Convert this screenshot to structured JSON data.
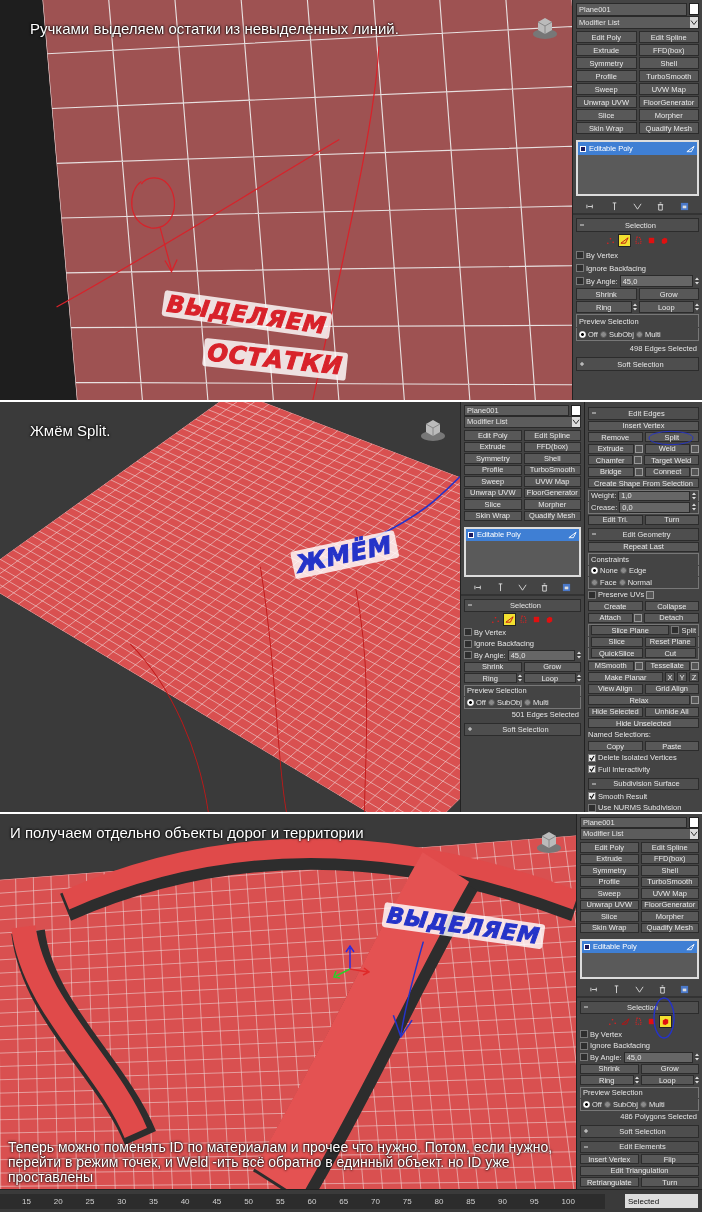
{
  "steps": [
    {
      "caption": "Ручками выделяем остатки из невыделенных линий.",
      "notes": [
        {
          "text": "ВЫДЕЛЯЕМ",
          "color": "#d8222a"
        },
        {
          "text": "ОСТАТКИ",
          "color": "#d8222a"
        }
      ],
      "panels": [
        {
          "object_name": "Plane001",
          "modifier_list": "Modifier List",
          "modifiers": [
            "Edit Poly",
            "Edit Spline",
            "Extrude",
            "FFD(box)",
            "Symmetry",
            "Shell",
            "Profile",
            "TurboSmooth",
            "Sweep",
            "UVW Map",
            "Unwrap UVW",
            "FloorGenerator",
            "Slice",
            "Morpher",
            "Skin Wrap",
            "Quadify Mesh"
          ],
          "stack": [
            {
              "label": "Editable Poly",
              "selected": true
            }
          ],
          "rollouts": [
            {
              "title": "Selection",
              "expanded": true,
              "rows": [
                {
                  "kind": "row",
                  "controls": [
                    {
                      "kind": "subobj",
                      "selected": false
                    },
                    {
                      "kind": "subobj",
                      "selected": true
                    },
                    {
                      "kind": "subobj",
                      "selected": false
                    },
                    {
                      "kind": "subobj",
                      "selected": false
                    },
                    {
                      "kind": "subobj",
                      "selected": false
                    }
                  ]
                },
                {
                  "kind": "row",
                  "controls": [
                    {
                      "kind": "checkbox",
                      "label": "By Vertex",
                      "checked": false
                    }
                  ]
                },
                {
                  "kind": "row",
                  "controls": [
                    {
                      "kind": "checkbox",
                      "label": "Ignore Backfacing",
                      "checked": false
                    }
                  ]
                },
                {
                  "kind": "row",
                  "controls": [
                    {
                      "kind": "checkbox",
                      "label": "By Angle:",
                      "checked": false
                    },
                    {
                      "kind": "spinner",
                      "value": "45,0"
                    }
                  ]
                },
                {
                  "kind": "row",
                  "controls": [
                    {
                      "kind": "button",
                      "label": "Shrink"
                    },
                    {
                      "kind": "button",
                      "label": "Grow"
                    }
                  ]
                },
                {
                  "kind": "row",
                  "controls": [
                    {
                      "kind": "spin_button",
                      "label": "Ring"
                    },
                    {
                      "kind": "spin_button",
                      "label": "Loop"
                    }
                  ]
                },
                {
                  "kind": "group",
                  "title": "Preview Selection",
                  "rows": [
                    {
                      "kind": "row",
                      "controls": [
                        {
                          "kind": "radio",
                          "label": "Off",
                          "selected": true
                        },
                        {
                          "kind": "radio",
                          "label": "SubObj",
                          "selected": false
                        },
                        {
                          "kind": "radio",
                          "label": "Multi",
                          "selected": false
                        }
                      ]
                    }
                  ]
                },
                {
                  "kind": "row",
                  "controls": [
                    {
                      "kind": "status",
                      "text": "498 Edges Selected"
                    }
                  ]
                }
              ]
            },
            {
              "title": "Soft Selection",
              "expanded": false
            }
          ]
        }
      ]
    },
    {
      "caption": "Жмём Split.",
      "notes": [
        {
          "text": "ЖМЁМ",
          "color": "#2533c8"
        }
      ],
      "panels": [
        {
          "object_name": "Plane001",
          "modifier_list": "Modifier List",
          "modifiers": [
            "Edit Poly",
            "Edit Spline",
            "Extrude",
            "FFD(box)",
            "Symmetry",
            "Shell",
            "Profile",
            "TurboSmooth",
            "Sweep",
            "UVW Map",
            "Unwrap UVW",
            "FloorGenerator",
            "Slice",
            "Morpher",
            "Skin Wrap",
            "Quadify Mesh"
          ],
          "stack": [
            {
              "label": "Editable Poly",
              "selected": true
            }
          ],
          "rollouts": [
            {
              "title": "Selection",
              "expanded": true,
              "rows": [
                {
                  "kind": "row",
                  "controls": [
                    {
                      "kind": "subobj",
                      "selected": false
                    },
                    {
                      "kind": "subobj",
                      "selected": true
                    },
                    {
                      "kind": "subobj",
                      "selected": false
                    },
                    {
                      "kind": "subobj",
                      "selected": false
                    },
                    {
                      "kind": "subobj",
                      "selected": false
                    }
                  ]
                },
                {
                  "kind": "row",
                  "controls": [
                    {
                      "kind": "checkbox",
                      "label": "By Vertex",
                      "checked": false
                    }
                  ]
                },
                {
                  "kind": "row",
                  "controls": [
                    {
                      "kind": "checkbox",
                      "label": "Ignore Backfacing",
                      "checked": false
                    }
                  ]
                },
                {
                  "kind": "row",
                  "controls": [
                    {
                      "kind": "checkbox",
                      "label": "By Angle:",
                      "checked": false
                    },
                    {
                      "kind": "spinner",
                      "value": "45,0"
                    }
                  ]
                },
                {
                  "kind": "row",
                  "controls": [
                    {
                      "kind": "button",
                      "label": "Shrink"
                    },
                    {
                      "kind": "button",
                      "label": "Grow"
                    }
                  ]
                },
                {
                  "kind": "row",
                  "controls": [
                    {
                      "kind": "spin_button",
                      "label": "Ring"
                    },
                    {
                      "kind": "spin_button",
                      "label": "Loop"
                    }
                  ]
                },
                {
                  "kind": "group",
                  "title": "Preview Selection",
                  "rows": [
                    {
                      "kind": "row",
                      "controls": [
                        {
                          "kind": "radio",
                          "label": "Off",
                          "selected": true
                        },
                        {
                          "kind": "radio",
                          "label": "SubObj",
                          "selected": false
                        },
                        {
                          "kind": "radio",
                          "label": "Multi",
                          "selected": false
                        }
                      ]
                    }
                  ]
                },
                {
                  "kind": "row",
                  "controls": [
                    {
                      "kind": "status",
                      "text": "501 Edges Selected"
                    }
                  ]
                }
              ]
            },
            {
              "title": "Soft Selection",
              "expanded": false
            }
          ]
        },
        {
          "rollouts": [
            {
              "title": "Edit Edges",
              "expanded": true,
              "rows": [
                {
                  "kind": "row",
                  "controls": [
                    {
                      "kind": "button",
                      "label": "Insert Vertex"
                    }
                  ]
                },
                {
                  "kind": "row",
                  "controls": [
                    {
                      "kind": "button",
                      "label": "Remove"
                    },
                    {
                      "kind": "button",
                      "label": "Split"
                    }
                  ]
                },
                {
                  "kind": "row",
                  "controls": [
                    {
                      "kind": "button_opt",
                      "label": "Extrude"
                    },
                    {
                      "kind": "button_opt",
                      "label": "Weld"
                    }
                  ]
                },
                {
                  "kind": "row",
                  "controls": [
                    {
                      "kind": "button_opt",
                      "label": "Chamfer"
                    },
                    {
                      "kind": "button",
                      "label": "Target Weld"
                    }
                  ]
                },
                {
                  "kind": "row",
                  "controls": [
                    {
                      "kind": "button_opt",
                      "label": "Bridge"
                    },
                    {
                      "kind": "button_opt",
                      "label": "Connect"
                    }
                  ]
                },
                {
                  "kind": "row",
                  "controls": [
                    {
                      "kind": "button",
                      "label": "Create Shape From Selection"
                    }
                  ]
                },
                {
                  "kind": "group",
                  "rows": [
                    {
                      "kind": "row",
                      "controls": [
                        {
                          "kind": "spinner",
                          "label": "Weight:",
                          "value": "1,0"
                        }
                      ]
                    },
                    {
                      "kind": "row",
                      "controls": [
                        {
                          "kind": "spinner",
                          "label": "Crease:",
                          "value": "0,0"
                        }
                      ]
                    }
                  ]
                },
                {
                  "kind": "row",
                  "controls": [
                    {
                      "kind": "button",
                      "label": "Edit Tri."
                    },
                    {
                      "kind": "button",
                      "label": "Turn"
                    }
                  ]
                }
              ]
            },
            {
              "title": "Edit Geometry",
              "expanded": true,
              "rows": [
                {
                  "kind": "row",
                  "controls": [
                    {
                      "kind": "button",
                      "label": "Repeat Last"
                    }
                  ]
                },
                {
                  "kind": "group",
                  "title": "Constraints",
                  "rows": [
                    {
                      "kind": "row",
                      "controls": [
                        {
                          "kind": "radio",
                          "label": "None",
                          "selected": true
                        },
                        {
                          "kind": "radio",
                          "label": "Edge",
                          "selected": false
                        }
                      ]
                    },
                    {
                      "kind": "row",
                      "controls": [
                        {
                          "kind": "radio",
                          "label": "Face",
                          "selected": false
                        },
                        {
                          "kind": "radio",
                          "label": "Normal",
                          "selected": false
                        }
                      ]
                    }
                  ]
                },
                {
                  "kind": "row",
                  "controls": [
                    {
                      "kind": "checkbox",
                      "label": "Preserve UVs",
                      "checked": false
                    },
                    {
                      "kind": "settings"
                    }
                  ]
                },
                {
                  "kind": "row",
                  "controls": [
                    {
                      "kind": "button",
                      "label": "Create"
                    },
                    {
                      "kind": "button",
                      "label": "Collapse"
                    }
                  ]
                },
                {
                  "kind": "row",
                  "controls": [
                    {
                      "kind": "button_opt",
                      "label": "Attach"
                    },
                    {
                      "kind": "button",
                      "label": "Detach"
                    }
                  ]
                },
                {
                  "kind": "group",
                  "rows": [
                    {
                      "kind": "row",
                      "controls": [
                        {
                          "kind": "button",
                          "label": "Slice Plane"
                        },
                        {
                          "kind": "checkbox",
                          "label": "Split",
                          "checked": false
                        }
                      ]
                    },
                    {
                      "kind": "row",
                      "controls": [
                        {
                          "kind": "button",
                          "label": "Slice"
                        },
                        {
                          "kind": "button",
                          "label": "Reset Plane"
                        }
                      ]
                    },
                    {
                      "kind": "row",
                      "controls": [
                        {
                          "kind": "button",
                          "label": "QuickSlice"
                        },
                        {
                          "kind": "button",
                          "label": "Cut"
                        }
                      ]
                    }
                  ]
                },
                {
                  "kind": "row",
                  "controls": [
                    {
                      "kind": "button_opt",
                      "label": "MSmooth"
                    },
                    {
                      "kind": "button_opt",
                      "label": "Tessellate"
                    }
                  ]
                },
                {
                  "kind": "row",
                  "controls": [
                    {
                      "kind": "button",
                      "label": "Make Planar"
                    },
                    {
                      "kind": "axis",
                      "label": "X"
                    },
                    {
                      "kind": "axis",
                      "label": "Y"
                    },
                    {
                      "kind": "axis",
                      "label": "Z"
                    }
                  ]
                },
                {
                  "kind": "row",
                  "controls": [
                    {
                      "kind": "button",
                      "label": "View Align"
                    },
                    {
                      "kind": "button",
                      "label": "Grid Align"
                    }
                  ]
                },
                {
                  "kind": "row",
                  "controls": [
                    {
                      "kind": "button_opt",
                      "label": "Relax"
                    }
                  ]
                },
                {
                  "kind": "row",
                  "controls": [
                    {
                      "kind": "button",
                      "label": "Hide Selected"
                    },
                    {
                      "kind": "button",
                      "label": "Unhide All"
                    }
                  ]
                },
                {
                  "kind": "row",
                  "controls": [
                    {
                      "kind": "button",
                      "label": "Hide Unselected"
                    }
                  ]
                },
                {
                  "kind": "row",
                  "controls": [
                    {
                      "kind": "label",
                      "text": "Named Selections:"
                    }
                  ]
                },
                {
                  "kind": "row",
                  "controls": [
                    {
                      "kind": "button",
                      "label": "Copy"
                    },
                    {
                      "kind": "button",
                      "label": "Paste"
                    }
                  ]
                },
                {
                  "kind": "row",
                  "controls": [
                    {
                      "kind": "checkbox",
                      "label": "Delete Isolated Vertices",
                      "checked": true
                    }
                  ]
                },
                {
                  "kind": "row",
                  "controls": [
                    {
                      "kind": "checkbox",
                      "label": "Full Interactivity",
                      "checked": true
                    }
                  ]
                }
              ]
            },
            {
              "title": "Subdivision Surface",
              "expanded": true,
              "rows": [
                {
                  "kind": "row",
                  "controls": [
                    {
                      "kind": "checkbox",
                      "label": "Smooth Result",
                      "checked": true
                    }
                  ]
                },
                {
                  "kind": "row",
                  "controls": [
                    {
                      "kind": "checkbox",
                      "label": "Use NURMS Subdivision",
                      "checked": false
                    }
                  ]
                }
              ]
            }
          ]
        }
      ]
    },
    {
      "caption": "И получаем отдельно объекты дорог и территории",
      "bottom_caption": "Теперь можно поменять ID по материалам и прочее что нужно. Потом, если нужно, перейти в режим точек, и Weld -ить всё обратно в единный объект. но ID уже проставлены",
      "notes": [
        {
          "text": "ВЫДЕЛЯЕМ",
          "color": "#2533c8"
        }
      ],
      "panels": [
        {
          "object_name": "Plane001",
          "modifier_list": "Modifier List",
          "modifiers": [
            "Edit Poly",
            "Edit Spline",
            "Extrude",
            "FFD(box)",
            "Symmetry",
            "Shell",
            "Profile",
            "TurboSmooth",
            "Sweep",
            "UVW Map",
            "Unwrap UVW",
            "FloorGenerator",
            "Slice",
            "Morpher",
            "Skin Wrap",
            "Quadify Mesh"
          ],
          "stack": [
            {
              "label": "Editable Poly",
              "selected": true
            }
          ],
          "rollouts": [
            {
              "title": "Selection",
              "expanded": true,
              "rows": [
                {
                  "kind": "row",
                  "controls": [
                    {
                      "kind": "subobj",
                      "selected": false
                    },
                    {
                      "kind": "subobj",
                      "selected": false
                    },
                    {
                      "kind": "subobj",
                      "selected": false
                    },
                    {
                      "kind": "subobj",
                      "selected": false
                    },
                    {
                      "kind": "subobj",
                      "selected": true
                    }
                  ]
                },
                {
                  "kind": "row",
                  "controls": [
                    {
                      "kind": "checkbox",
                      "label": "By Vertex",
                      "checked": false
                    }
                  ]
                },
                {
                  "kind": "row",
                  "controls": [
                    {
                      "kind": "checkbox",
                      "label": "Ignore Backfacing",
                      "checked": false
                    }
                  ]
                },
                {
                  "kind": "row",
                  "controls": [
                    {
                      "kind": "checkbox",
                      "label": "By Angle:",
                      "checked": false
                    },
                    {
                      "kind": "spinner",
                      "value": "45,0"
                    }
                  ]
                },
                {
                  "kind": "row",
                  "controls": [
                    {
                      "kind": "button",
                      "label": "Shrink"
                    },
                    {
                      "kind": "button",
                      "label": "Grow"
                    }
                  ]
                },
                {
                  "kind": "row",
                  "controls": [
                    {
                      "kind": "spin_button",
                      "label": "Ring"
                    },
                    {
                      "kind": "spin_button",
                      "label": "Loop"
                    }
                  ]
                },
                {
                  "kind": "group",
                  "title": "Preview Selection",
                  "rows": [
                    {
                      "kind": "row",
                      "controls": [
                        {
                          "kind": "radio",
                          "label": "Off",
                          "selected": true
                        },
                        {
                          "kind": "radio",
                          "label": "SubObj",
                          "selected": false
                        },
                        {
                          "kind": "radio",
                          "label": "Multi",
                          "selected": false
                        }
                      ]
                    }
                  ]
                },
                {
                  "kind": "row",
                  "controls": [
                    {
                      "kind": "status",
                      "text": "486 Polygons Selected"
                    }
                  ]
                }
              ]
            },
            {
              "title": "Soft Selection",
              "expanded": false
            },
            {
              "title": "Edit Elements",
              "expanded": true,
              "rows": [
                {
                  "kind": "row",
                  "controls": [
                    {
                      "kind": "button",
                      "label": "Insert Vertex"
                    },
                    {
                      "kind": "button",
                      "label": "Flip"
                    }
                  ]
                },
                {
                  "kind": "row",
                  "controls": [
                    {
                      "kind": "button",
                      "label": "Edit Triangulation"
                    }
                  ]
                },
                {
                  "kind": "row",
                  "controls": [
                    {
                      "kind": "button",
                      "label": "Retriangulate"
                    },
                    {
                      "kind": "button",
                      "label": "Turn"
                    }
                  ]
                }
              ]
            }
          ]
        }
      ],
      "timeline": {
        "ticks": [
          "15",
          "20",
          "25",
          "30",
          "35",
          "40",
          "45",
          "50",
          "55",
          "60",
          "65",
          "70",
          "75",
          "80",
          "85",
          "90",
          "95",
          "100"
        ],
        "selection_set": "Selected"
      }
    }
  ]
}
